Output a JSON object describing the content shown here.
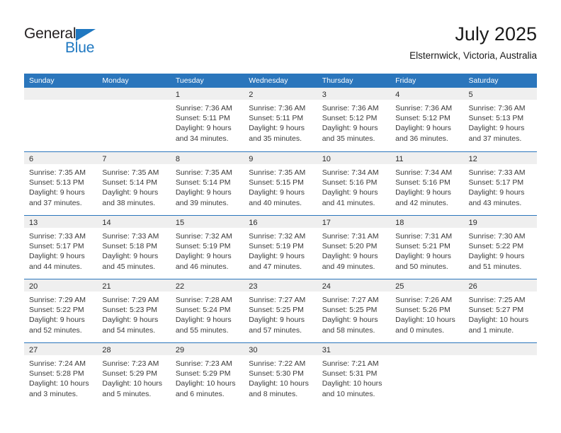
{
  "brand": {
    "name_primary": "General",
    "name_secondary": "Blue",
    "triangle_icon": "blue-triangle-icon",
    "primary_color": "#231f20",
    "secondary_color": "#1f78c1"
  },
  "header": {
    "title": "July 2025",
    "subtitle": "Elsternwick, Victoria, Australia"
  },
  "theme": {
    "header_blue": "#2b76bc",
    "day_band_gray": "#efefef",
    "text_color": "#3a3a3a"
  },
  "calendar": {
    "weekday_headers": [
      "Sunday",
      "Monday",
      "Tuesday",
      "Wednesday",
      "Thursday",
      "Friday",
      "Saturday"
    ],
    "weeks": [
      [
        {
          "day": "",
          "empty": true
        },
        {
          "day": "",
          "empty": true
        },
        {
          "day": "1",
          "sunrise": "Sunrise: 7:36 AM",
          "sunset": "Sunset: 5:11 PM",
          "daylight1": "Daylight: 9 hours",
          "daylight2": "and 34 minutes."
        },
        {
          "day": "2",
          "sunrise": "Sunrise: 7:36 AM",
          "sunset": "Sunset: 5:11 PM",
          "daylight1": "Daylight: 9 hours",
          "daylight2": "and 35 minutes."
        },
        {
          "day": "3",
          "sunrise": "Sunrise: 7:36 AM",
          "sunset": "Sunset: 5:12 PM",
          "daylight1": "Daylight: 9 hours",
          "daylight2": "and 35 minutes."
        },
        {
          "day": "4",
          "sunrise": "Sunrise: 7:36 AM",
          "sunset": "Sunset: 5:12 PM",
          "daylight1": "Daylight: 9 hours",
          "daylight2": "and 36 minutes."
        },
        {
          "day": "5",
          "sunrise": "Sunrise: 7:36 AM",
          "sunset": "Sunset: 5:13 PM",
          "daylight1": "Daylight: 9 hours",
          "daylight2": "and 37 minutes."
        }
      ],
      [
        {
          "day": "6",
          "sunrise": "Sunrise: 7:35 AM",
          "sunset": "Sunset: 5:13 PM",
          "daylight1": "Daylight: 9 hours",
          "daylight2": "and 37 minutes."
        },
        {
          "day": "7",
          "sunrise": "Sunrise: 7:35 AM",
          "sunset": "Sunset: 5:14 PM",
          "daylight1": "Daylight: 9 hours",
          "daylight2": "and 38 minutes."
        },
        {
          "day": "8",
          "sunrise": "Sunrise: 7:35 AM",
          "sunset": "Sunset: 5:14 PM",
          "daylight1": "Daylight: 9 hours",
          "daylight2": "and 39 minutes."
        },
        {
          "day": "9",
          "sunrise": "Sunrise: 7:35 AM",
          "sunset": "Sunset: 5:15 PM",
          "daylight1": "Daylight: 9 hours",
          "daylight2": "and 40 minutes."
        },
        {
          "day": "10",
          "sunrise": "Sunrise: 7:34 AM",
          "sunset": "Sunset: 5:16 PM",
          "daylight1": "Daylight: 9 hours",
          "daylight2": "and 41 minutes."
        },
        {
          "day": "11",
          "sunrise": "Sunrise: 7:34 AM",
          "sunset": "Sunset: 5:16 PM",
          "daylight1": "Daylight: 9 hours",
          "daylight2": "and 42 minutes."
        },
        {
          "day": "12",
          "sunrise": "Sunrise: 7:33 AM",
          "sunset": "Sunset: 5:17 PM",
          "daylight1": "Daylight: 9 hours",
          "daylight2": "and 43 minutes."
        }
      ],
      [
        {
          "day": "13",
          "sunrise": "Sunrise: 7:33 AM",
          "sunset": "Sunset: 5:17 PM",
          "daylight1": "Daylight: 9 hours",
          "daylight2": "and 44 minutes."
        },
        {
          "day": "14",
          "sunrise": "Sunrise: 7:33 AM",
          "sunset": "Sunset: 5:18 PM",
          "daylight1": "Daylight: 9 hours",
          "daylight2": "and 45 minutes."
        },
        {
          "day": "15",
          "sunrise": "Sunrise: 7:32 AM",
          "sunset": "Sunset: 5:19 PM",
          "daylight1": "Daylight: 9 hours",
          "daylight2": "and 46 minutes."
        },
        {
          "day": "16",
          "sunrise": "Sunrise: 7:32 AM",
          "sunset": "Sunset: 5:19 PM",
          "daylight1": "Daylight: 9 hours",
          "daylight2": "and 47 minutes."
        },
        {
          "day": "17",
          "sunrise": "Sunrise: 7:31 AM",
          "sunset": "Sunset: 5:20 PM",
          "daylight1": "Daylight: 9 hours",
          "daylight2": "and 49 minutes."
        },
        {
          "day": "18",
          "sunrise": "Sunrise: 7:31 AM",
          "sunset": "Sunset: 5:21 PM",
          "daylight1": "Daylight: 9 hours",
          "daylight2": "and 50 minutes."
        },
        {
          "day": "19",
          "sunrise": "Sunrise: 7:30 AM",
          "sunset": "Sunset: 5:22 PM",
          "daylight1": "Daylight: 9 hours",
          "daylight2": "and 51 minutes."
        }
      ],
      [
        {
          "day": "20",
          "sunrise": "Sunrise: 7:29 AM",
          "sunset": "Sunset: 5:22 PM",
          "daylight1": "Daylight: 9 hours",
          "daylight2": "and 52 minutes."
        },
        {
          "day": "21",
          "sunrise": "Sunrise: 7:29 AM",
          "sunset": "Sunset: 5:23 PM",
          "daylight1": "Daylight: 9 hours",
          "daylight2": "and 54 minutes."
        },
        {
          "day": "22",
          "sunrise": "Sunrise: 7:28 AM",
          "sunset": "Sunset: 5:24 PM",
          "daylight1": "Daylight: 9 hours",
          "daylight2": "and 55 minutes."
        },
        {
          "day": "23",
          "sunrise": "Sunrise: 7:27 AM",
          "sunset": "Sunset: 5:25 PM",
          "daylight1": "Daylight: 9 hours",
          "daylight2": "and 57 minutes."
        },
        {
          "day": "24",
          "sunrise": "Sunrise: 7:27 AM",
          "sunset": "Sunset: 5:25 PM",
          "daylight1": "Daylight: 9 hours",
          "daylight2": "and 58 minutes."
        },
        {
          "day": "25",
          "sunrise": "Sunrise: 7:26 AM",
          "sunset": "Sunset: 5:26 PM",
          "daylight1": "Daylight: 10 hours",
          "daylight2": "and 0 minutes."
        },
        {
          "day": "26",
          "sunrise": "Sunrise: 7:25 AM",
          "sunset": "Sunset: 5:27 PM",
          "daylight1": "Daylight: 10 hours",
          "daylight2": "and 1 minute."
        }
      ],
      [
        {
          "day": "27",
          "sunrise": "Sunrise: 7:24 AM",
          "sunset": "Sunset: 5:28 PM",
          "daylight1": "Daylight: 10 hours",
          "daylight2": "and 3 minutes."
        },
        {
          "day": "28",
          "sunrise": "Sunrise: 7:23 AM",
          "sunset": "Sunset: 5:29 PM",
          "daylight1": "Daylight: 10 hours",
          "daylight2": "and 5 minutes."
        },
        {
          "day": "29",
          "sunrise": "Sunrise: 7:23 AM",
          "sunset": "Sunset: 5:29 PM",
          "daylight1": "Daylight: 10 hours",
          "daylight2": "and 6 minutes."
        },
        {
          "day": "30",
          "sunrise": "Sunrise: 7:22 AM",
          "sunset": "Sunset: 5:30 PM",
          "daylight1": "Daylight: 10 hours",
          "daylight2": "and 8 minutes."
        },
        {
          "day": "31",
          "sunrise": "Sunrise: 7:21 AM",
          "sunset": "Sunset: 5:31 PM",
          "daylight1": "Daylight: 10 hours",
          "daylight2": "and 10 minutes."
        },
        {
          "day": "",
          "empty": true
        },
        {
          "day": "",
          "empty": true
        }
      ]
    ]
  }
}
